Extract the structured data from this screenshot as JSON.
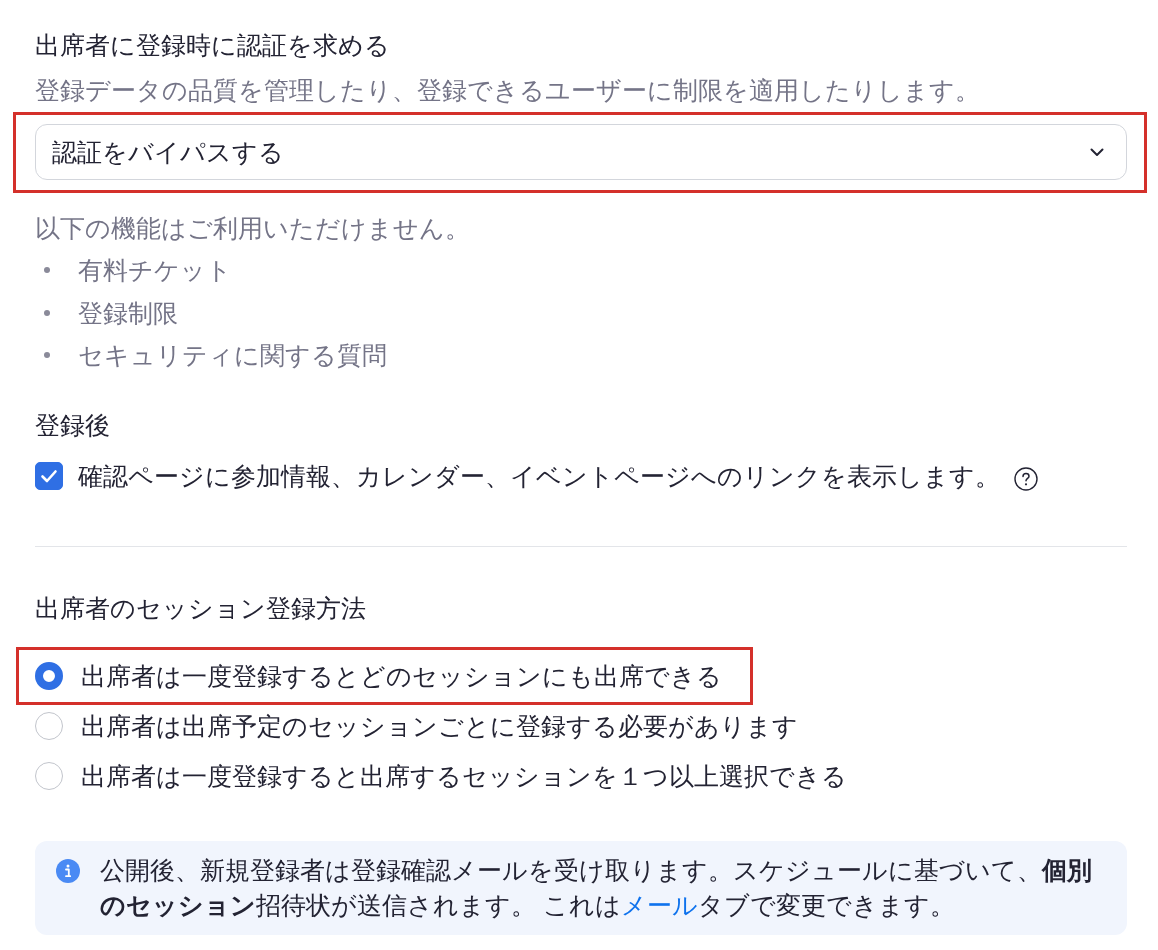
{
  "authentication": {
    "title": "出席者に登録時に認証を求める",
    "description": "登録データの品質を管理したり、登録できるユーザーに制限を適用したりします。",
    "select": {
      "value": "認証をバイパスする",
      "highlighted": true
    },
    "unavailable_note": "以下の機能はご利用いただけません。",
    "unavailable_features": [
      "有料チケット",
      "登録制限",
      "セキュリティに関する質問"
    ]
  },
  "after_registration": {
    "title": "登録後",
    "checkbox": {
      "label": "確認ページに参加情報、カレンダー、イベントページへのリンクを表示します。",
      "checked": true
    }
  },
  "session_registration": {
    "title": "出席者のセッション登録方法",
    "options": [
      {
        "label": "出席者は一度登録するとどのセッションにも出席できる",
        "selected": true,
        "highlighted": true
      },
      {
        "label": "出席者は出席予定のセッションごとに登録する必要があります",
        "selected": false,
        "highlighted": false
      },
      {
        "label": "出席者は一度登録すると出席するセッションを１つ以上選択できる",
        "selected": false,
        "highlighted": false
      }
    ]
  },
  "info_banner": {
    "text_before_link": "公開後、新規登録者は登録確認メールを受け取ります。スケジュールに基づいて、**個別のセッション**招待状が送信されます。 これは",
    "link": "メール",
    "text_after_link": "タブで変更できます。"
  }
}
